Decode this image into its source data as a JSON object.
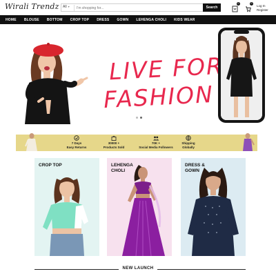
{
  "header": {
    "logo": "Wirali Trendz",
    "search": {
      "category": "All",
      "placeholder": "I'm shopping for...",
      "button_label": "Search"
    },
    "wishlist_count": "0",
    "cart_count": "0",
    "login_label": "Log In",
    "register_label": "Register"
  },
  "nav": {
    "items": [
      "HOME",
      "BLOUSE",
      "BOTTOM",
      "CROP TOP",
      "DRESS",
      "GOWN",
      "LEHENGA CHOLI",
      "KIDS WEAR"
    ]
  },
  "hero": {
    "tagline_line1": "LIVE FOR",
    "tagline_line2": "FASHION",
    "accent_color": "#e8284e",
    "slides": 2,
    "active_slide": 1
  },
  "features": {
    "background": "#e6d78a",
    "items": [
      {
        "line1": "7 Days",
        "line2": "Easy Returns",
        "icon": "return-box-icon"
      },
      {
        "line1": "30000 +",
        "line2": "Products Sold",
        "icon": "shopping-bag-icon"
      },
      {
        "line1": "70K +",
        "line2": "Social Media Followers",
        "icon": "followers-icon"
      },
      {
        "line1": "Shipping",
        "line2": "Globally",
        "icon": "globe-icon"
      }
    ]
  },
  "categories": [
    {
      "line1": "CROP TOP",
      "line2": "",
      "bg": "#e3f4f2"
    },
    {
      "line1": "LEHENGA",
      "line2": "CHOLI",
      "bg": "#f7e1ee"
    },
    {
      "line1": "DRESS &",
      "line2": "GOWN",
      "bg": "#dcebf2"
    }
  ],
  "section": {
    "new_launch": "NEW LAUNCH"
  }
}
